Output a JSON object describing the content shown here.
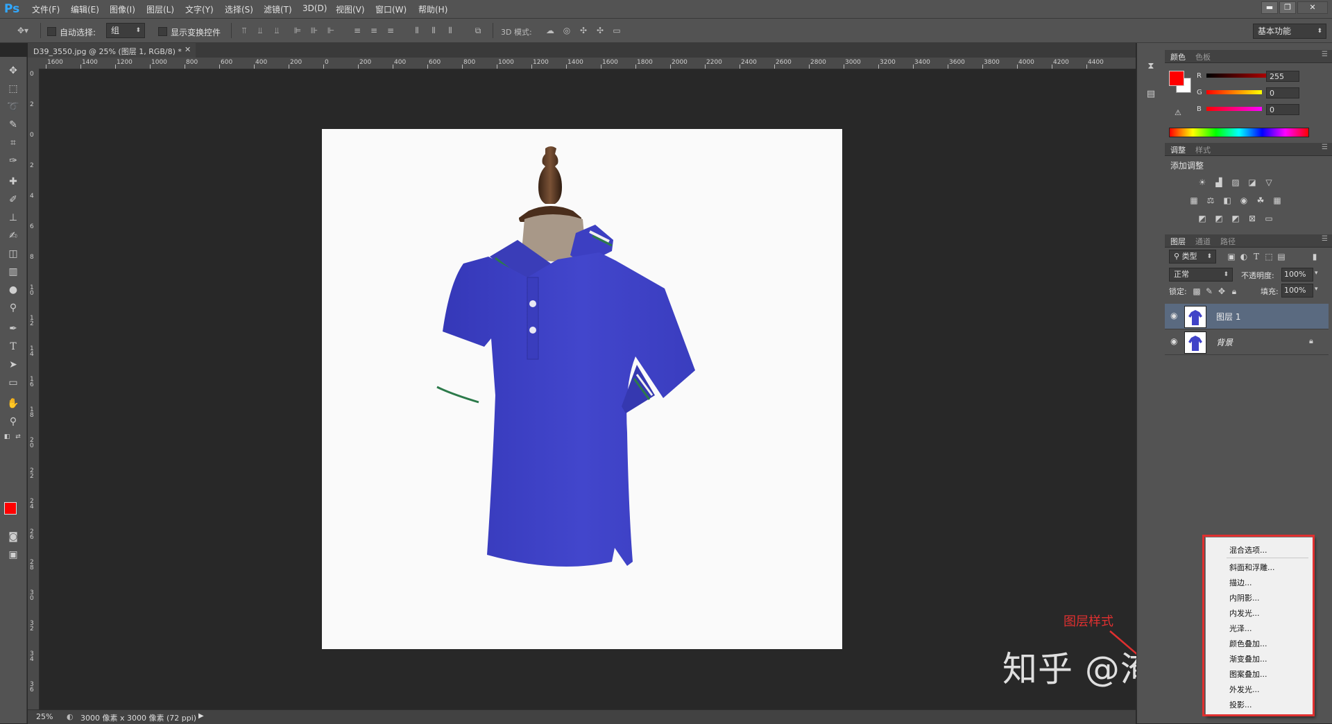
{
  "app": {
    "logo": "Ps",
    "workspace": "基本功能"
  },
  "menu": [
    "文件(F)",
    "编辑(E)",
    "图像(I)",
    "图层(L)",
    "文字(Y)",
    "选择(S)",
    "滤镜(T)",
    "3D(D)",
    "视图(V)",
    "窗口(W)",
    "帮助(H)"
  ],
  "window_buttons": {
    "minimize": "▬",
    "restore": "❐",
    "close": "✕"
  },
  "options": {
    "auto_select_label": "自动选择:",
    "auto_select_value": "组",
    "show_transform_label": "显示变换控件",
    "mode3d_label": "3D 模式:"
  },
  "document": {
    "tab_title": "D39_3550.jpg @ 25% (图层 1, RGB/8) *",
    "zoom": "25%",
    "size_info": "3000 像素 x 3000 像素 (72 ppi)"
  },
  "ruler": {
    "top_ticks": [
      "1600",
      "1400",
      "1200",
      "1000",
      "800",
      "600",
      "400",
      "200",
      "0",
      "200",
      "400",
      "600",
      "800",
      "1000",
      "1200",
      "1400",
      "1600",
      "1800",
      "2000",
      "2200",
      "2400",
      "2600",
      "2800",
      "3000",
      "3200",
      "3400",
      "3600",
      "3800",
      "4000",
      "4200",
      "4400"
    ],
    "left_ticks": [
      "0",
      "2",
      "0",
      "2",
      "4",
      "6",
      "8",
      "1 0",
      "1 2",
      "1 4",
      "1 6",
      "1 8",
      "2 0",
      "2 2",
      "2 4",
      "2 6",
      "2 8",
      "3 0",
      "3 2",
      "3 4",
      "3 6"
    ]
  },
  "color_panel": {
    "tabs": [
      "颜色",
      "色板"
    ],
    "channels": [
      {
        "name": "R",
        "value": "255"
      },
      {
        "name": "G",
        "value": "0"
      },
      {
        "name": "B",
        "value": "0"
      }
    ],
    "foreground": "#ff0000",
    "background": "#ffffff"
  },
  "adjust_panel": {
    "tabs": [
      "调整",
      "样式"
    ],
    "title": "添加调整"
  },
  "layers_panel": {
    "tabs": [
      "图层",
      "通道",
      "路径"
    ],
    "filter_kind": "类型",
    "blend_mode": "正常",
    "opacity_label": "不透明度:",
    "opacity_value": "100%",
    "lock_label": "锁定:",
    "fill_label": "填充:",
    "fill_value": "100%",
    "layers": [
      {
        "name": "图层 1",
        "selected": true
      },
      {
        "name": "背景",
        "selected": false
      }
    ]
  },
  "layer_style_menu": {
    "items": [
      "混合选项...",
      "斜面和浮雕...",
      "描边...",
      "内阴影...",
      "内发光...",
      "光泽...",
      "颜色叠加...",
      "渐变叠加...",
      "图案叠加...",
      "外发光...",
      "投影..."
    ]
  },
  "annotation": "图层样式",
  "watermark": "知乎 @淹死de鱼",
  "colors": {
    "shirt": "#4043c8",
    "annotation": "#e03030",
    "selected_layer": "#5a6a80"
  }
}
